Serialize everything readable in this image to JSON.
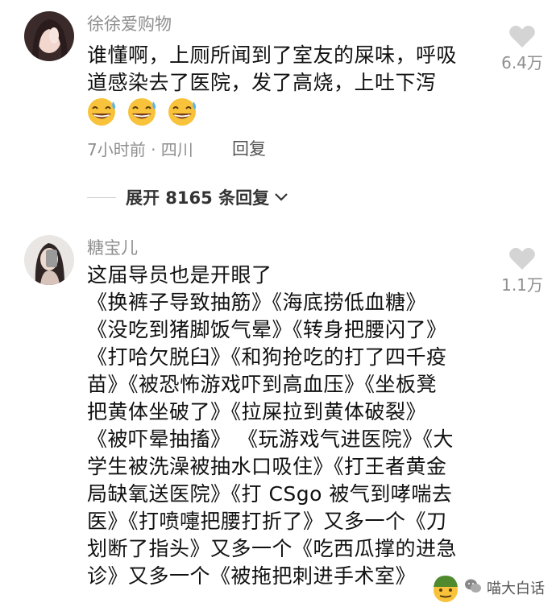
{
  "comments": [
    {
      "username": "徐徐爱购物",
      "text_lines": [
        "谁懂啊，上厕所闻到了室友的屎味，呼吸",
        "道感染去了医院，发了高烧，上吐下泻"
      ],
      "emoji": [
        "laughing-with-sweat-emoji",
        "laughing-with-sweat-emoji",
        "laughing-with-sweat-emoji"
      ],
      "meta": "7小时前 · 四川",
      "reply_label": "回复",
      "likes": "6.4万",
      "expand_label": "展开 8165 条回复"
    },
    {
      "username": "糖宝儿",
      "text_lines": [
        "这届导员也是开眼了",
        "《换裤子导致抽筋》《海底捞低血糖》",
        "《没吃到猪脚饭气晕》《转身把腰闪了》",
        "《打哈欠脱臼》《和狗抢吃的打了四千疫",
        "苗》《被恐怖游戏吓到高血压》《坐板凳",
        "把黄体坐破了》《拉屎拉到黄体破裂》",
        "《被吓晕抽搐》 《玩游戏气进医院》《大",
        "学生被洗澡被抽水口吸住》《打王者黄金",
        "局缺氧送医院》《打 CSgo 被气到哮喘去",
        "医》《打喷嚏把腰打折了》又多一个《刀",
        "划断了指头》又多一个《吃西瓜撑的进急",
        "诊》又多一个《被拖把刺进手术室》"
      ],
      "likes": "1.1万"
    }
  ],
  "watermark": {
    "text": "喵大白话"
  },
  "colors": {
    "meta_gray": "#8f8f8f",
    "heart_gray": "#d4d4d4",
    "emoji_yellow": "#f8c33a"
  }
}
